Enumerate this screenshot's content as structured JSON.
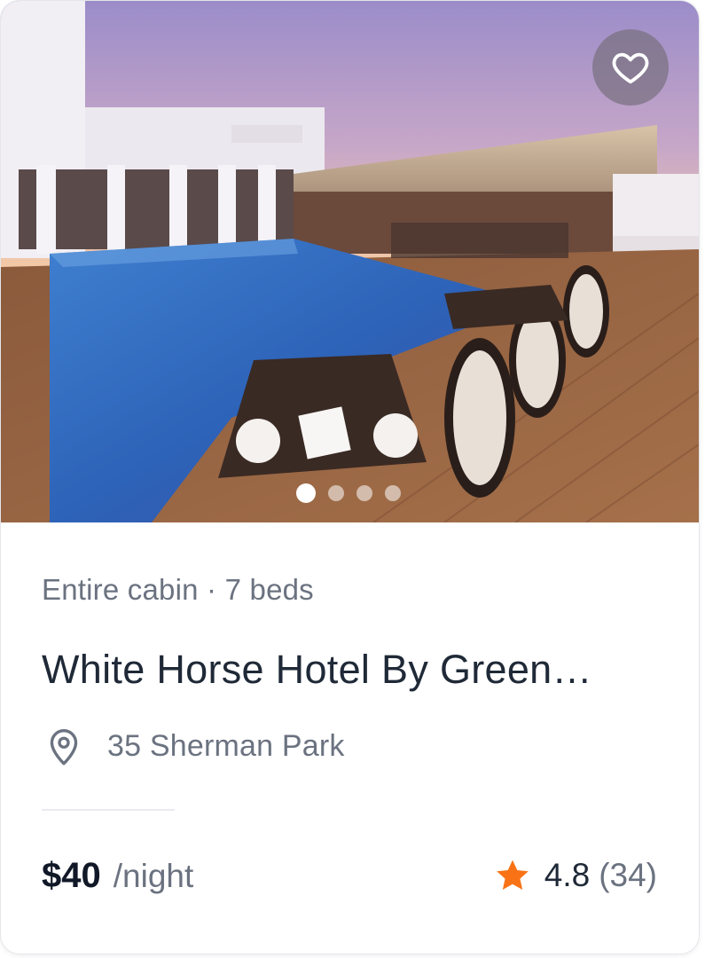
{
  "listing": {
    "photo": "rooftop-pool-restaurant-photo",
    "favorite_icon": "heart-outline-icon",
    "carousel": {
      "count": 4,
      "active": 1
    },
    "meta": "Entire cabin · 7 beds",
    "title": "White Horse Hotel By Green…",
    "location_icon": "map-pin-icon",
    "address": "35 Sherman Park",
    "price": "$40",
    "price_unit": "/night",
    "rating_icon": "star-icon",
    "rating": "4.8",
    "review_count": "(34)"
  },
  "colors": {
    "star": "#f97316",
    "title": "#1f2937",
    "muted": "#6b7280",
    "price": "#111827"
  }
}
